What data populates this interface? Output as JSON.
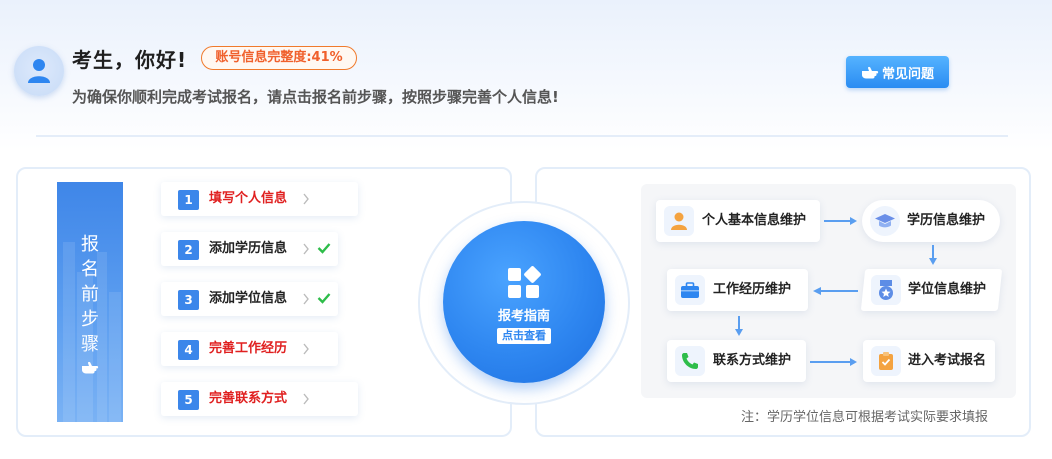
{
  "header": {
    "greeting": "考生，你好!",
    "completion_badge": "账号信息完整度:41%",
    "subtitle": "为确保你顺利完成考试报名，请点击报名前步骤，按照步骤完善个人信息!",
    "faq_label": "常见问题"
  },
  "steps_panel": {
    "banner_title": "报名前步骤",
    "steps": [
      {
        "number": "1",
        "label": "填写个人信息",
        "done": false,
        "color": "#e02020"
      },
      {
        "number": "2",
        "label": "添加学历信息",
        "done": true,
        "color": "#222222"
      },
      {
        "number": "3",
        "label": "添加学位信息",
        "done": true,
        "color": "#222222"
      },
      {
        "number": "4",
        "label": "完善工作经历",
        "done": false,
        "color": "#e02020"
      },
      {
        "number": "5",
        "label": "完善联系方式",
        "done": false,
        "color": "#e02020"
      }
    ]
  },
  "guide": {
    "title": "报考指南",
    "view_button": "点击查看"
  },
  "flow": {
    "nodes": [
      {
        "label": "个人基本信息维护",
        "icon": "person-icon"
      },
      {
        "label": "学历信息维护",
        "icon": "graduation-cap-icon"
      },
      {
        "label": "学位信息维护",
        "icon": "medal-icon"
      },
      {
        "label": "工作经历维护",
        "icon": "briefcase-icon"
      },
      {
        "label": "联系方式维护",
        "icon": "phone-icon"
      },
      {
        "label": "进入考试报名",
        "icon": "clipboard-icon"
      }
    ],
    "note": "注：学历学位信息可根据考试实际要求填报"
  },
  "colors": {
    "accent": "#2e86f0",
    "warning": "#f07a2c",
    "error": "#e02020",
    "success": "#2ebd4a"
  }
}
